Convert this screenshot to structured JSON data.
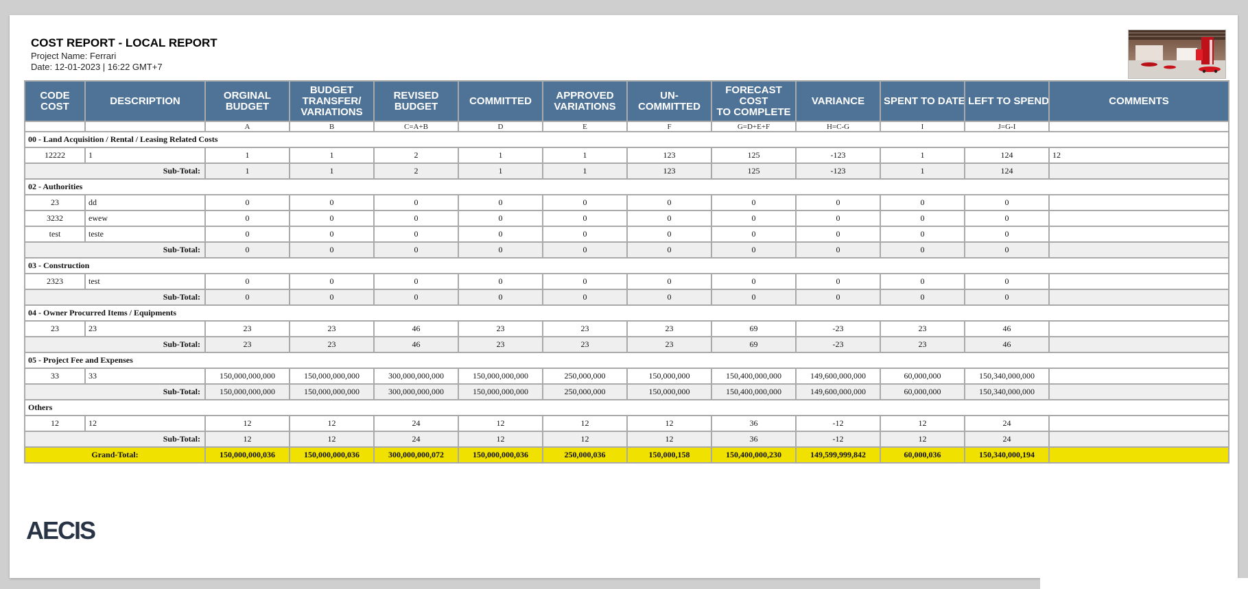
{
  "report": {
    "title": "COST REPORT - LOCAL REPORT",
    "project_line": "Project Name: Ferrari",
    "date_line": "Date: 12-01-2023 | 16:22 GMT+7",
    "logo_text": "AECIS"
  },
  "columns": [
    {
      "key": "code",
      "label": "CODE\nCOST",
      "formula": ""
    },
    {
      "key": "description",
      "label": "DESCRIPTION",
      "formula": ""
    },
    {
      "key": "original",
      "label": "ORGINAL\nBUDGET",
      "formula": "A"
    },
    {
      "key": "transfer",
      "label": "BUDGET\nTRANSFER/\nVARIATIONS",
      "formula": "B"
    },
    {
      "key": "revised",
      "label": "REVISED\nBUDGET",
      "formula": "C=A+B"
    },
    {
      "key": "committed",
      "label": "COMMITTED",
      "formula": "D"
    },
    {
      "key": "approved",
      "label": "APPROVED\nVARIATIONS",
      "formula": "E"
    },
    {
      "key": "uncommitted",
      "label": "UN-\nCOMMITTED",
      "formula": "F"
    },
    {
      "key": "forecast",
      "label": "FORECAST\nCOST\nTO COMPLETE",
      "formula": "G=D+E+F"
    },
    {
      "key": "variance",
      "label": "VARIANCE",
      "formula": "H=C-G"
    },
    {
      "key": "spent",
      "label": "SPENT TO DATE",
      "formula": "I"
    },
    {
      "key": "left",
      "label": "LEFT TO SPEND",
      "formula": "J=G-I"
    },
    {
      "key": "comments",
      "label": "COMMENTS",
      "formula": ""
    }
  ],
  "subtotal_label": "Sub-Total:",
  "sections": [
    {
      "name": "00 - Land Acquisition / Rental / Leasing Related Costs",
      "rows": [
        {
          "code": "12222",
          "description": "1",
          "values": [
            "1",
            "1",
            "2",
            "1",
            "1",
            "123",
            "125",
            "-123",
            "1",
            "124"
          ],
          "comments": "12"
        }
      ],
      "subtotal": [
        "1",
        "1",
        "2",
        "1",
        "1",
        "123",
        "125",
        "-123",
        "1",
        "124"
      ]
    },
    {
      "name": "02 - Authorities",
      "rows": [
        {
          "code": "23",
          "description": "dd",
          "values": [
            "0",
            "0",
            "0",
            "0",
            "0",
            "0",
            "0",
            "0",
            "0",
            "0"
          ],
          "comments": ""
        },
        {
          "code": "3232",
          "description": "ewew",
          "values": [
            "0",
            "0",
            "0",
            "0",
            "0",
            "0",
            "0",
            "0",
            "0",
            "0"
          ],
          "comments": ""
        },
        {
          "code": "test",
          "description": "teste",
          "values": [
            "0",
            "0",
            "0",
            "0",
            "0",
            "0",
            "0",
            "0",
            "0",
            "0"
          ],
          "comments": ""
        }
      ],
      "subtotal": [
        "0",
        "0",
        "0",
        "0",
        "0",
        "0",
        "0",
        "0",
        "0",
        "0"
      ]
    },
    {
      "name": "03 - Construction",
      "rows": [
        {
          "code": "2323",
          "description": "test",
          "values": [
            "0",
            "0",
            "0",
            "0",
            "0",
            "0",
            "0",
            "0",
            "0",
            "0"
          ],
          "comments": ""
        }
      ],
      "subtotal": [
        "0",
        "0",
        "0",
        "0",
        "0",
        "0",
        "0",
        "0",
        "0",
        "0"
      ]
    },
    {
      "name": "04 - Owner Procurred Items / Equipments",
      "rows": [
        {
          "code": "23",
          "description": "23",
          "values": [
            "23",
            "23",
            "46",
            "23",
            "23",
            "23",
            "69",
            "-23",
            "23",
            "46"
          ],
          "comments": ""
        }
      ],
      "subtotal": [
        "23",
        "23",
        "46",
        "23",
        "23",
        "23",
        "69",
        "-23",
        "23",
        "46"
      ]
    },
    {
      "name": "05 - Project Fee and Expenses",
      "rows": [
        {
          "code": "33",
          "description": "33",
          "values": [
            "150,000,000,000",
            "150,000,000,000",
            "300,000,000,000",
            "150,000,000,000",
            "250,000,000",
            "150,000,000",
            "150,400,000,000",
            "149,600,000,000",
            "60,000,000",
            "150,340,000,000"
          ],
          "comments": ""
        }
      ],
      "subtotal": [
        "150,000,000,000",
        "150,000,000,000",
        "300,000,000,000",
        "150,000,000,000",
        "250,000,000",
        "150,000,000",
        "150,400,000,000",
        "149,600,000,000",
        "60,000,000",
        "150,340,000,000"
      ]
    },
    {
      "name": "Others",
      "rows": [
        {
          "code": "12",
          "description": "12",
          "values": [
            "12",
            "12",
            "24",
            "12",
            "12",
            "12",
            "36",
            "-12",
            "12",
            "24"
          ],
          "comments": ""
        }
      ],
      "subtotal": [
        "12",
        "12",
        "24",
        "12",
        "12",
        "12",
        "36",
        "-12",
        "12",
        "24"
      ]
    }
  ],
  "grand_total": {
    "label": "Grand-Total:",
    "values": [
      "150,000,000,036",
      "150,000,000,036",
      "300,000,000,072",
      "150,000,000,036",
      "250,000,036",
      "150,000,158",
      "150,400,000,230",
      "149,599,999,842",
      "60,000,036",
      "150,340,000,194"
    ]
  },
  "colors": {
    "header_bg": "#4e7397",
    "grand_total_bg": "#f0e100",
    "subtotal_bg": "#efefef",
    "negative_text": "#c00000",
    "logo": "#283445"
  }
}
